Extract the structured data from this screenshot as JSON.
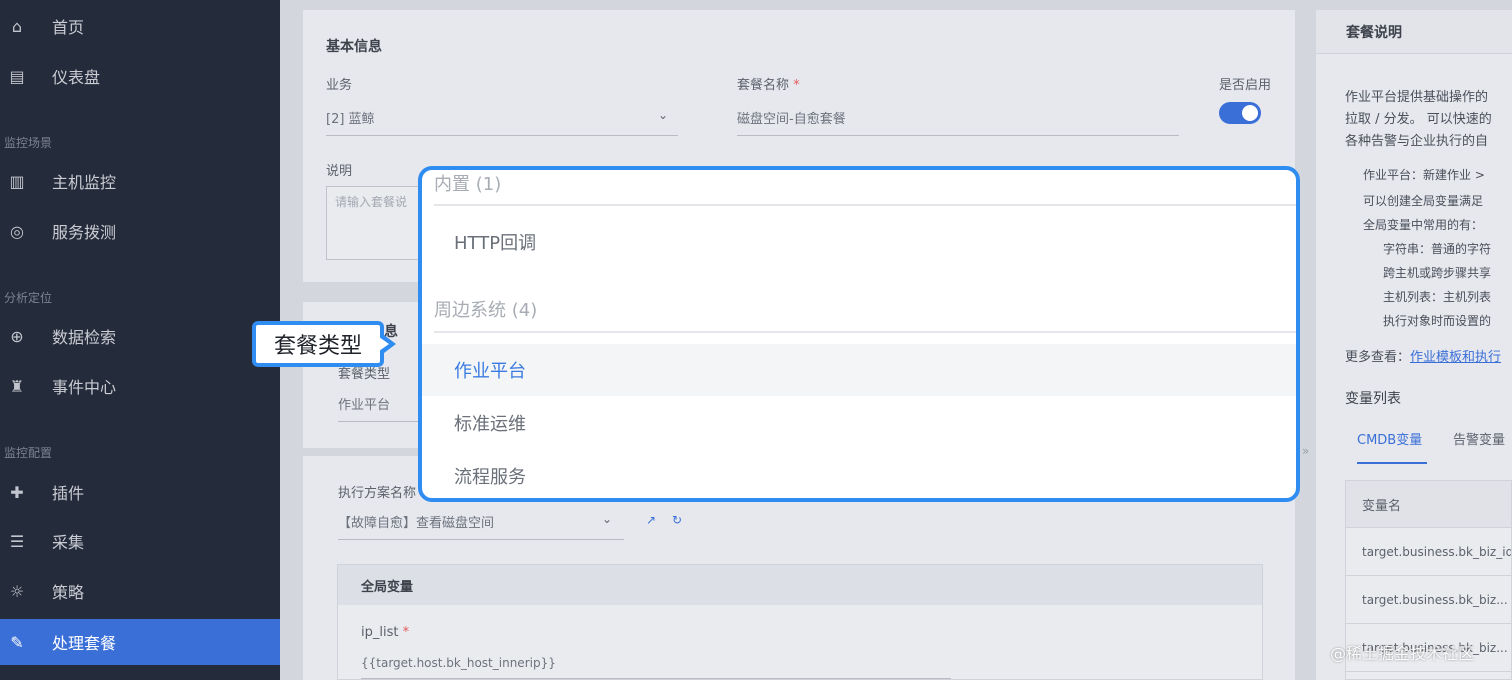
{
  "sidebar": {
    "items": [
      {
        "label": "首页",
        "icon": "home-icon"
      },
      {
        "label": "仪表盘",
        "icon": "dashboard-icon"
      },
      {
        "label": "主机监控",
        "icon": "host-icon"
      },
      {
        "label": "服务拨测",
        "icon": "probe-icon"
      },
      {
        "label": "数据检索",
        "icon": "search-icon"
      },
      {
        "label": "事件中心",
        "icon": "alarm-icon"
      },
      {
        "label": "插件",
        "icon": "plugin-icon"
      },
      {
        "label": "采集",
        "icon": "collect-icon"
      },
      {
        "label": "策略",
        "icon": "bulb-icon"
      },
      {
        "label": "处理套餐",
        "icon": "wrench-icon",
        "active": true
      }
    ],
    "groups": [
      "监控场景",
      "分析定位",
      "监控配置"
    ]
  },
  "basic": {
    "title": "基本信息",
    "business_label": "业务",
    "business_value": "[2] 蓝鲸",
    "name_label": "套餐名称",
    "name_value": "磁盘空间-自愈套餐",
    "enable_label": "是否启用",
    "desc_label": "说明",
    "desc_placeholder": "请输入套餐说"
  },
  "type_section": {
    "title_tail": "息",
    "type_label": "套餐类型",
    "type_value": "作业平台"
  },
  "exec": {
    "plan_label": "执行方案名称",
    "plan_value": "【故障自愈】查看磁盘空间",
    "globals_title": "全局变量",
    "var_name": "ip_list",
    "var_value": "{{target.host.bk_host_innerip}}"
  },
  "dropdown": {
    "groups": [
      {
        "header": "内置 (1)",
        "options": [
          "HTTP回调"
        ]
      },
      {
        "header": "周边系统 (4)",
        "options": [
          "作业平台",
          "标准运维",
          "流程服务"
        ]
      }
    ],
    "selected": "作业平台"
  },
  "callout": {
    "text": "套餐类型"
  },
  "right_panel": {
    "title": "套餐说明",
    "intro": [
      "作业平台提供基础操作的",
      "拉取 / 分发。 可以快速的",
      "各种告警与企业执行的自"
    ],
    "steps": [
      "作业平台：新建作业 >",
      "可以创建全局变量满足",
      "全局变量中常用的有：",
      "字符串：普通的字符",
      "跨主机或跨步骤共享",
      "主机列表：主机列表",
      "执行对象时而设置的"
    ],
    "more_prefix": "更多查看：",
    "more_link": "作业模板和执行",
    "vars_title": "变量列表",
    "tabs": [
      "CMDB变量",
      "告警变量"
    ],
    "table_header": "变量名",
    "table_rows": [
      "target.business.bk_biz_id",
      "target.business.bk_biz...",
      "target.business.bk_biz..."
    ]
  },
  "watermark": "@稀土掘金技术社区"
}
